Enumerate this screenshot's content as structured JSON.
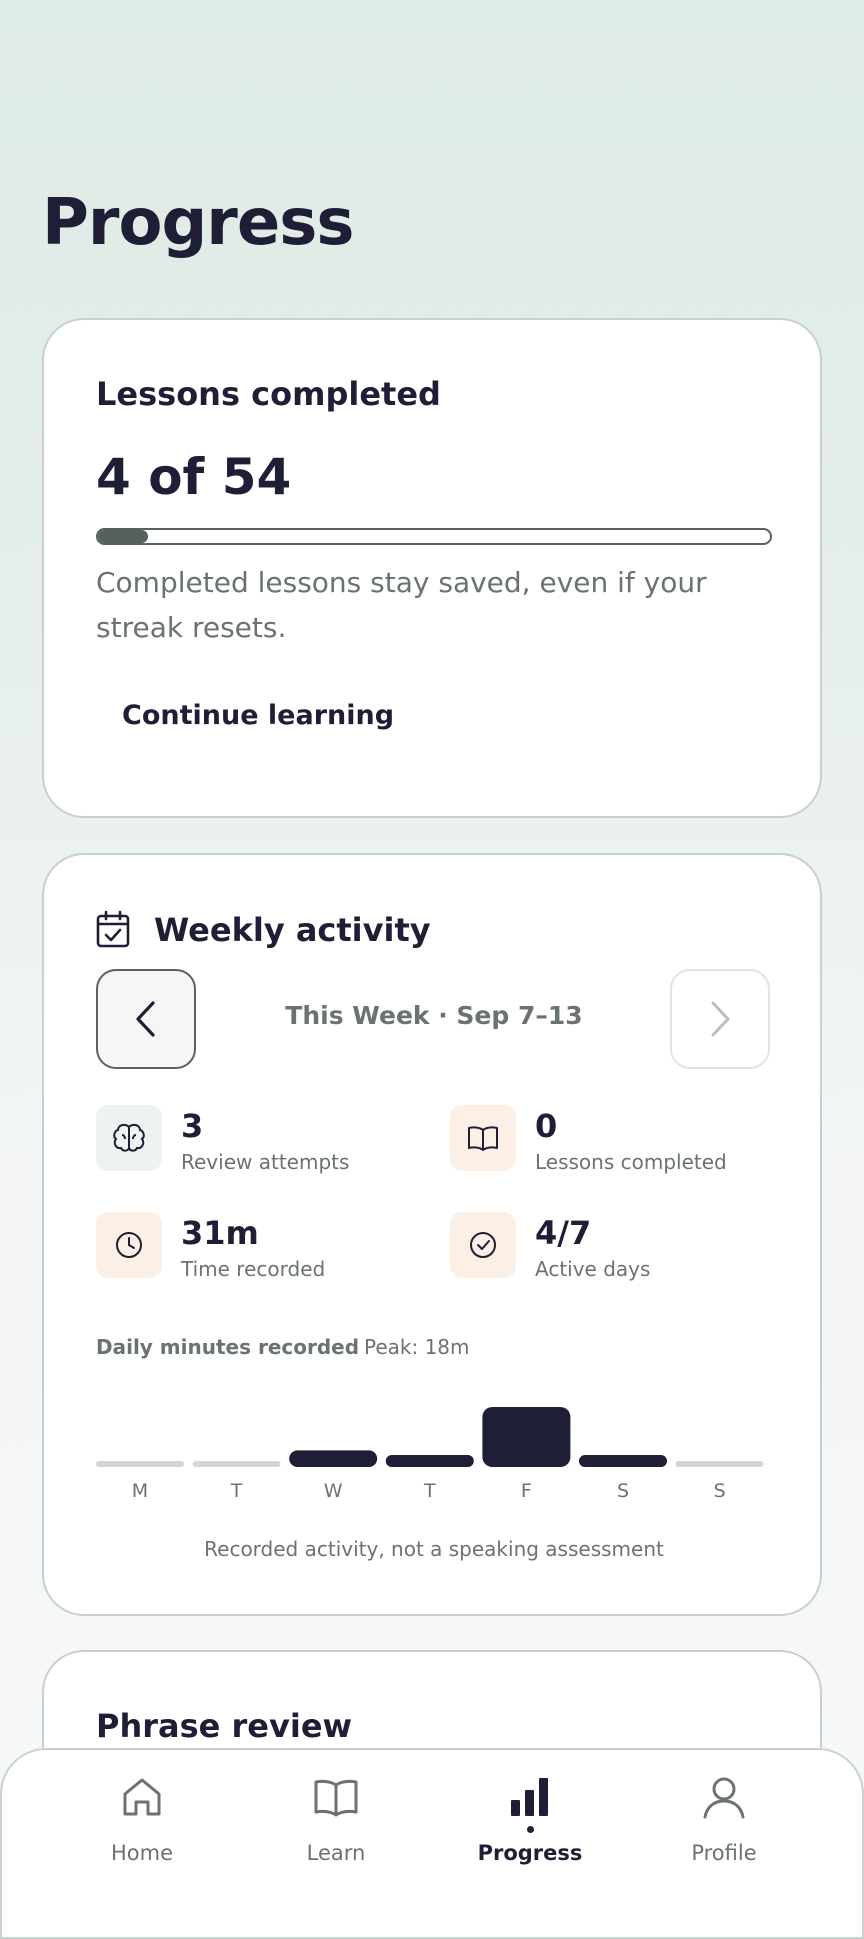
{
  "page": {
    "title": "Progress"
  },
  "lessons_card": {
    "title": "Lessons completed",
    "count_text": "4 of 54",
    "completed": 4,
    "total": 54,
    "note": "Completed lessons stay saved, even if your streak resets.",
    "cta": "Continue learning"
  },
  "weekly": {
    "title": "Weekly activity",
    "week_label": "This Week  ·  Sep 7–13",
    "stats": [
      {
        "value": "3",
        "label": "Review attempts",
        "icon": "brain-icon"
      },
      {
        "value": "0",
        "label": "Lessons completed",
        "icon": "book-icon"
      },
      {
        "value": "31m",
        "label": "Time recorded",
        "icon": "clock-icon"
      },
      {
        "value": "4/7",
        "label": "Active days",
        "icon": "check-circle-icon"
      }
    ],
    "chart_heading": "Daily minutes recorded",
    "peak": "Peak: 18m",
    "footer": "Recorded activity, not a speaking assessment"
  },
  "chart_data": {
    "type": "bar",
    "categories": [
      "M",
      "T",
      "W",
      "T",
      "F",
      "S",
      "S"
    ],
    "values": [
      0,
      0,
      5,
      2,
      18,
      2,
      0
    ],
    "ylim": [
      0,
      18
    ],
    "grid": false,
    "bar_color": "#1e1f36",
    "empty_color": "#cfd6d3"
  },
  "phrase_card": {
    "title": "Phrase review"
  },
  "tabbar": {
    "tabs": [
      {
        "label": "Home",
        "icon": "home-icon",
        "active": false
      },
      {
        "label": "Learn",
        "icon": "open-book-icon",
        "active": false
      },
      {
        "label": "Progress",
        "icon": "bar-chart-icon",
        "active": true
      },
      {
        "label": "Profile",
        "icon": "user-icon",
        "active": false
      }
    ]
  },
  "colors": {
    "text_primary": "#1e1f36",
    "text_muted": "#6a7370",
    "card_border": "#c5d2cc",
    "progress_fill": "#56605c",
    "peach_chip": "#fbefe6",
    "gray_chip": "#eef2f0"
  }
}
